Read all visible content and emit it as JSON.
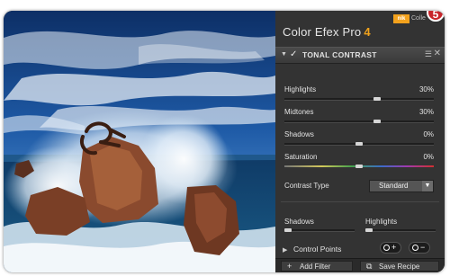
{
  "app": {
    "title": "Color Efex Pro",
    "version": "4",
    "brand": "nik",
    "brand_suffix": "Colle",
    "badge": "5"
  },
  "filter": {
    "name": "TONAL CONTRAST",
    "enabled": true,
    "sliders": [
      {
        "label": "Highlights",
        "value": "30%",
        "level": 0.62
      },
      {
        "label": "Midtones",
        "value": "30%",
        "level": 0.62
      },
      {
        "label": "Shadows",
        "value": "0%",
        "level": 0.5
      },
      {
        "label": "Saturation",
        "value": "0%",
        "level": 0.5
      }
    ],
    "contrast_type": {
      "label": "Contrast Type",
      "selected": "Standard"
    },
    "protect": {
      "shadows": "Shadows",
      "highlights": "Highlights",
      "shadows_level": 0.05,
      "highlights_level": 0.05
    }
  },
  "control_points": {
    "label": "Control Points"
  },
  "footer": {
    "add_filter": "Add Filter",
    "save_recipe": "Save Recipe"
  },
  "icons": {
    "collapse": "triangle-down-icon",
    "check": "check-icon",
    "menu": "menu-icon",
    "close": "close-icon",
    "add_cp": "add-control-point-icon",
    "remove_cp": "remove-control-point-icon",
    "plus": "plus-icon",
    "recipe": "recipe-icon"
  },
  "colors": {
    "accent": "#f0a21c",
    "badge": "#c8252a",
    "panel": "#333333"
  }
}
